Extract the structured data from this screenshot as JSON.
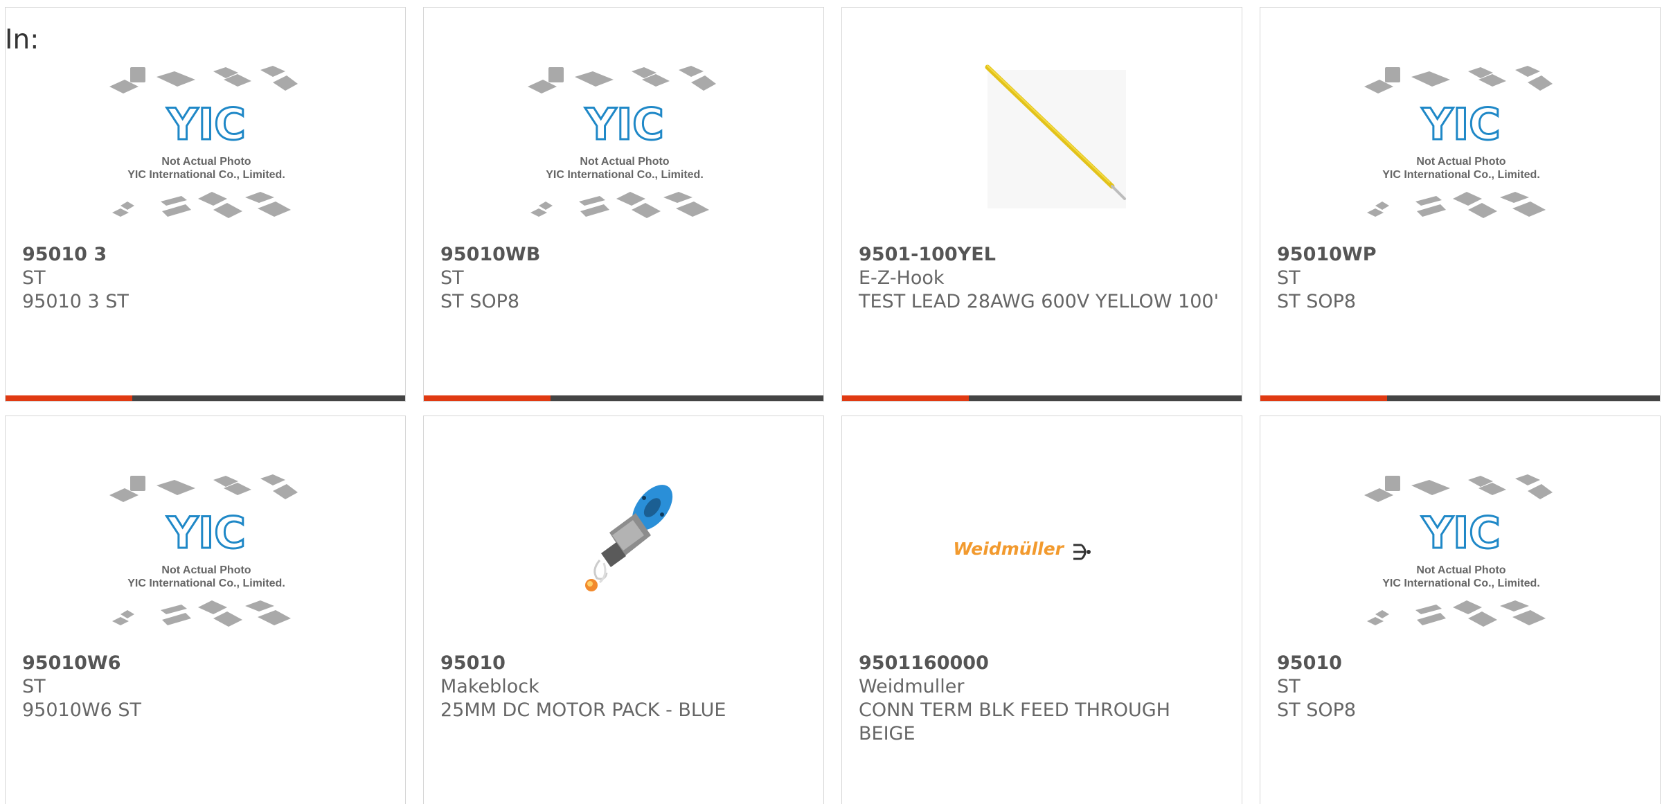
{
  "header": {
    "label": "In:"
  },
  "colors": {
    "accent": "#e03a12",
    "bar": "#444444",
    "border": "#d6d6d6",
    "text": "#666666"
  },
  "placeholder": {
    "logo_text": "YIC",
    "line1": "Not Actual Photo",
    "line2": "YIC International Co., Limited."
  },
  "products": [
    {
      "part": "95010 3",
      "maker": "ST",
      "desc": "95010 3 ST",
      "image": "placeholder-yic"
    },
    {
      "part": "95010WB",
      "maker": "ST",
      "desc": "ST SOP8",
      "image": "placeholder-yic"
    },
    {
      "part": "9501-100YEL",
      "maker": "E-Z-Hook",
      "desc": "TEST LEAD 28AWG 600V YELLOW 100'",
      "image": "yellow-wire"
    },
    {
      "part": "95010WP",
      "maker": "ST",
      "desc": "ST SOP8",
      "image": "placeholder-yic"
    },
    {
      "part": "95010W6",
      "maker": "ST",
      "desc": "95010W6 ST",
      "image": "placeholder-yic"
    },
    {
      "part": "95010",
      "maker": "Makeblock",
      "desc": "25MM DC MOTOR PACK - BLUE",
      "image": "motor-pack"
    },
    {
      "part": "9501160000",
      "maker": "Weidmuller",
      "desc": "CONN TERM BLK FEED THROUGH BEIGE",
      "image": "weidmuller-logo",
      "logo_text": "Weidmüller"
    },
    {
      "part": "95010",
      "maker": "ST",
      "desc": "ST SOP8",
      "image": "placeholder-yic"
    }
  ]
}
